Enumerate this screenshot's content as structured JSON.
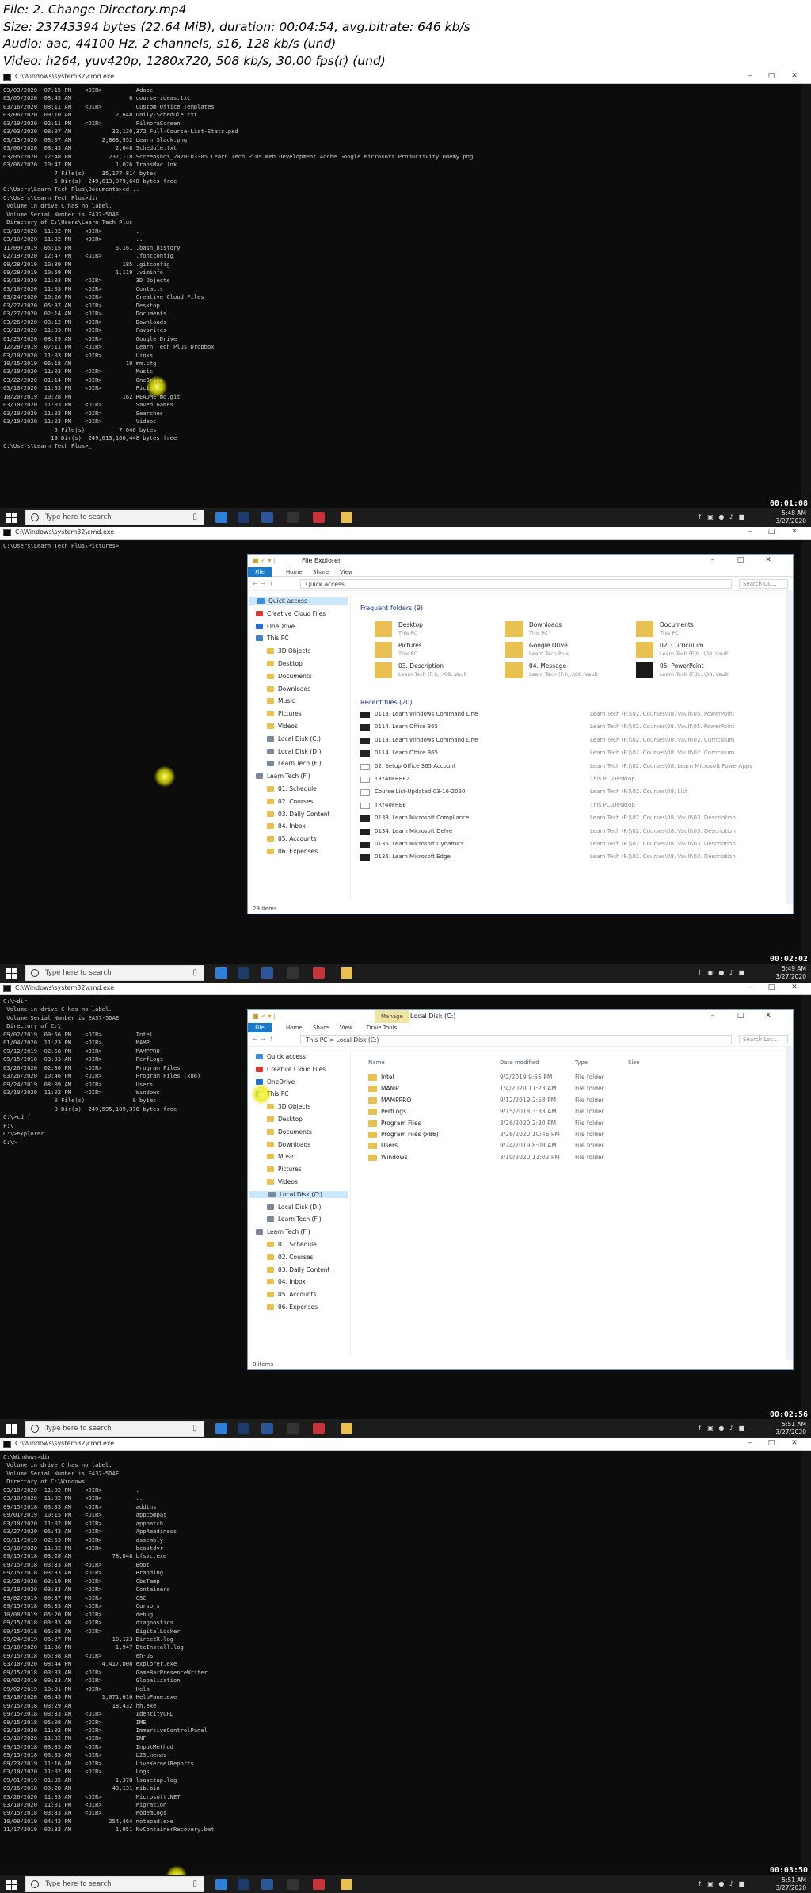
{
  "header": {
    "file_line": "File: 2. Change Directory.mp4",
    "size_line": "Size: 23743394 bytes (22.64 MiB), duration: 00:04:54, avg.bitrate: 646 kb/s",
    "audio_line": "Audio: aac, 44100 Hz, 2 channels, s16, 128 kb/s (und)",
    "video_line": "Video: h264, yuv420p, 1280x720, 508 kb/s, 30.00 fps(r) (und)"
  },
  "frames": [
    {
      "window_title": "C:\\Windows\\system32\\cmd.exe",
      "terminal_lines": [
        "03/03/2020  07:15 PM    <DIR>          Adobe",
        "03/05/2020  08:45 AM                 0 course-ideas.txt",
        "03/16/2020  08:11 AM    <DIR>          Custom Office Templates",
        "03/06/2020  09:10 AM             2,648 Daily-Schedule.txt",
        "03/19/2020  02:11 PM    <DIR>          FilmoraScreen",
        "03/03/2020  08:07 AM            32,130,372 Full-Course-List-Stats.psd",
        "03/13/2020  08:07 AM         2,803,952 Learn_Slack.png",
        "03/06/2020  08:43 AM             2,648 Schedule.txt",
        "03/05/2020  12:48 PM           237,118 Screenshot_2020-03-05 Learn Tech Plus Web Development Adobe Google Microsoft Productivity Udemy.png",
        "03/06/2020  10:47 PM             1,076 TransMac.lnk",
        "               7 File(s)     35,177,814 bytes",
        "               5 Dir(s)  249,613,979,648 bytes free",
        "",
        "C:\\Users\\Learn Tech Plus\\Documents>cd ..",
        "",
        "C:\\Users\\Learn Tech Plus>dir",
        " Volume in drive C has no label.",
        " Volume Serial Number is EA37-5DAE",
        "",
        " Directory of C:\\Users\\Learn Tech Plus",
        "",
        "03/10/2020  11:02 PM    <DIR>          .",
        "03/10/2020  11:02 PM    <DIR>          ..",
        "11/09/2019  05:15 PM             6,161 .bash_history",
        "02/19/2020  12:47 PM    <DIR>          .fontconfig",
        "09/28/2019  10:39 PM               185 .gitconfig",
        "09/28/2019  10:59 PM             1,119 .viminfo",
        "03/10/2020  11:03 PM    <DIR>          3D Objects",
        "03/10/2020  11:03 PM    <DIR>          Contacts",
        "03/24/2020  10:26 PM    <DIR>          Creative Cloud Files",
        "03/27/2020  05:37 AM    <DIR>          Desktop",
        "03/27/2020  02:14 AM    <DIR>          Documents",
        "03/26/2020  03:12 PM    <DIR>          Downloads",
        "03/10/2020  11:03 PM    <DIR>          Favorites",
        "01/23/2020  08:29 AM    <DIR>          Google Drive",
        "12/28/2019  07:11 PM    <DIR>          Learn Tech Plus Dropbox",
        "03/10/2020  11:03 PM    <DIR>          Links",
        "10/15/2019  06:18 AM                19 mm.cfg",
        "03/10/2020  11:03 PM    <DIR>          Music",
        "03/22/2020  01:14 PM    <DIR>          OneDrive",
        "03/10/2020  11:03 PM    <DIR>          Pictures",
        "10/20/2019  10:28 PM               162 README.md.git",
        "03/10/2020  11:03 PM    <DIR>          Saved Games",
        "03/10/2020  11:03 PM    <DIR>          Searches",
        "03/10/2020  11:03 PM    <DIR>          Videos",
        "               5 File(s)          7,646 bytes",
        "              19 Dir(s)  249,613,160,448 bytes free",
        "",
        "C:\\Users\\Learn Tech Plus>_"
      ],
      "taskbar_search": "Type here to search",
      "clock_time": "5:48 AM",
      "clock_date": "3/27/2020",
      "timestamp": "00:01:08"
    },
    {
      "window_title": "C:\\Windows\\system32\\cmd.exe",
      "terminal_lines": [
        "C:\\Users\\Learn Tech Plus\\Pictures>"
      ],
      "explorer": {
        "title": "File Explorer",
        "tabs": [
          "File",
          "Home",
          "Share",
          "View"
        ],
        "address": "Quick access",
        "search_placeholder": "Search Qu...",
        "status": "29 items",
        "nav_items": [
          "Quick access",
          "Creative Cloud Files",
          "OneDrive",
          "This PC",
          "3D Objects",
          "Desktop",
          "Documents",
          "Downloads",
          "Music",
          "Pictures",
          "Videos",
          "Local Disk (C:)",
          "Local Disk (D:)",
          "Learn Tech (F:)",
          "Learn Tech (F:)",
          "01. Schedule",
          "02. Courses",
          "03. Daily Content",
          "04. Inbox",
          "05. Accounts",
          "06. Expenses"
        ],
        "frequent_header": "Frequent folders (9)",
        "frequent": [
          {
            "name": "Desktop",
            "sub": "This PC"
          },
          {
            "name": "Downloads",
            "sub": "This PC"
          },
          {
            "name": "Documents",
            "sub": "This PC"
          },
          {
            "name": "Pictures",
            "sub": "This PC"
          },
          {
            "name": "Google Drive",
            "sub": "Learn Tech Plus"
          },
          {
            "name": "02. Curriculum",
            "sub": "Learn Tech (F:)\\...\\08. Vault"
          },
          {
            "name": "03. Description",
            "sub": "Learn Tech (F:)\\...\\08. Vault"
          },
          {
            "name": "04. Message",
            "sub": "Learn Tech (F:)\\...\\08. Vault"
          },
          {
            "name": "05. PowerPoint",
            "sub": "Learn Tech (F:)\\...\\08. Vault"
          }
        ],
        "recent_header": "Recent files (20)",
        "recent": [
          {
            "name": "0113. Learn Windows Command Line",
            "path": "Learn Tech (F:)\\02. Courses\\08. Vault\\05. PowerPoint"
          },
          {
            "name": "0114. Learn Office 365",
            "path": "Learn Tech (F:)\\02. Courses\\08. Vault\\05. PowerPoint"
          },
          {
            "name": "0113. Learn Windows Command Line",
            "path": "Learn Tech (F:)\\02. Courses\\08. Vault\\02. Curriculum"
          },
          {
            "name": "0114. Learn Office 365",
            "path": "Learn Tech (F:)\\02. Courses\\08. Vault\\02. Curriculum"
          },
          {
            "name": "02. Setup Office 365 Account",
            "path": "Learn Tech (F:)\\02. Courses\\08. Learn Microsoft PowerApps"
          },
          {
            "name": "TRY40FREE2",
            "path": "This PC\\Desktop"
          },
          {
            "name": "Course List-Updated-03-16-2020",
            "path": "Learn Tech (F:)\\02. Courses\\08. List"
          },
          {
            "name": "TRY40FREE",
            "path": "This PC\\Desktop"
          },
          {
            "name": "0133. Learn Microsoft Compliance",
            "path": "Learn Tech (F:)\\02. Courses\\08. Vault\\03. Description"
          },
          {
            "name": "0134. Learn Microsoft Delve",
            "path": "Learn Tech (F:)\\02. Courses\\08. Vault\\03. Description"
          },
          {
            "name": "0135. Learn Microsoft Dynamics",
            "path": "Learn Tech (F:)\\02. Courses\\08. Vault\\03. Description"
          },
          {
            "name": "0136. Learn Microsoft Edge",
            "path": "Learn Tech (F:)\\02. Courses\\08. Vault\\03. Description"
          }
        ]
      },
      "taskbar_search": "Type here to search",
      "clock_time": "5:49 AM",
      "clock_date": "3/27/2020",
      "timestamp": "00:02:02"
    },
    {
      "window_title": "C:\\Windows\\system32\\cmd.exe",
      "terminal_lines": [
        "C:\\>dir",
        " Volume in drive C has no label.",
        " Volume Serial Number is EA37-5DAE",
        "",
        " Directory of C:\\",
        "",
        "09/02/2019  09:56 PM    <DIR>          Intel",
        "01/04/2020  11:23 PM    <DIR>          MAMP",
        "09/12/2019  02:58 PM    <DIR>          MAMPPRO",
        "09/15/2018  03:33 AM    <DIR>          PerfLogs",
        "03/26/2020  02:30 PM    <DIR>          Program Files",
        "03/26/2020  10:46 PM    <DIR>          Program Files (x86)",
        "09/24/2019  08:09 AM    <DIR>          Users",
        "03/10/2020  11:02 PM    <DIR>          Windows",
        "               0 File(s)              0 bytes",
        "               8 Dir(s)  249,595,109,376 bytes free",
        "",
        "C:\\>cd f:",
        "F:\\",
        "",
        "C:\\>explorer .",
        "",
        "C:\\>"
      ],
      "explorer": {
        "title": "Local Disk (C:)",
        "manage": "Manage",
        "tabs": [
          "File",
          "Home",
          "Share",
          "View",
          "Drive Tools"
        ],
        "address": "This PC  >  Local Disk (C:)",
        "search_placeholder": "Search Loc...",
        "status": "8 items",
        "columns": [
          "Name",
          "Date modified",
          "Type",
          "Size"
        ],
        "nav_items": [
          "Quick access",
          "Creative Cloud Files",
          "OneDrive",
          "This PC",
          "3D Objects",
          "Desktop",
          "Documents",
          "Downloads",
          "Music",
          "Pictures",
          "Videos",
          "Local Disk (C:)",
          "Local Disk (D:)",
          "Learn Tech (F:)",
          "Learn Tech (F:)",
          "01. Schedule",
          "02. Courses",
          "03. Daily Content",
          "04. Inbox",
          "05. Accounts",
          "06. Expenses"
        ],
        "rows": [
          {
            "name": "Intel",
            "date": "9/2/2019 9:56 PM",
            "type": "File folder"
          },
          {
            "name": "MAMP",
            "date": "1/4/2020 11:23 AM",
            "type": "File folder"
          },
          {
            "name": "MAMPPRO",
            "date": "9/12/2019 2:58 PM",
            "type": "File folder"
          },
          {
            "name": "PerfLogs",
            "date": "9/15/2018 3:33 AM",
            "type": "File folder"
          },
          {
            "name": "Program Files",
            "date": "3/26/2020 2:30 PM",
            "type": "File folder"
          },
          {
            "name": "Program Files (x86)",
            "date": "3/26/2020 10:46 PM",
            "type": "File folder"
          },
          {
            "name": "Users",
            "date": "9/24/2019 8:09 AM",
            "type": "File folder"
          },
          {
            "name": "Windows",
            "date": "3/10/2020 11:02 PM",
            "type": "File folder"
          }
        ]
      },
      "taskbar_search": "Type here to search",
      "clock_time": "5:51 AM",
      "clock_date": "3/27/2020",
      "timestamp": "00:02:56"
    },
    {
      "window_title": "C:\\Windows\\system32\\cmd.exe",
      "terminal_lines": [
        "C:\\Windows>dir",
        " Volume in drive C has no label.",
        " Volume Serial Number is EA37-5DAE",
        "",
        " Directory of C:\\Windows",
        "",
        "03/10/2020  11:02 PM    <DIR>          .",
        "03/10/2020  11:02 PM    <DIR>          ..",
        "09/15/2018  03:33 AM    <DIR>          addins",
        "09/01/2019  10:15 PM    <DIR>          appcompat",
        "03/10/2020  11:02 PM    <DIR>          apppatch",
        "03/27/2020  05:43 AM    <DIR>          AppReadiness",
        "09/11/2019  02:53 PM    <DIR>          assembly",
        "03/10/2020  11:02 PM    <DIR>          bcastdvr",
        "09/15/2018  03:28 AM            78,848 bfsvc.exe",
        "09/15/2018  03:33 AM    <DIR>          Boot",
        "09/15/2018  03:33 AM    <DIR>          Branding",
        "03/26/2020  03:19 PM    <DIR>          CbsTemp",
        "03/10/2020  03:33 AM    <DIR>          Containers",
        "09/02/2019  09:37 PM    <DIR>          CSC",
        "09/15/2018  03:33 AM    <DIR>          Cursors",
        "10/08/2019  05:20 PM    <DIR>          debug",
        "09/15/2018  03:33 AM    <DIR>          diagnostics",
        "09/15/2018  05:08 AM    <DIR>          DigitalLocker",
        "09/24/2019  06:27 PM            10,123 DirectX.log",
        "03/10/2020  11:36 PM             1,947 DtcInstall.log",
        "09/15/2018  05:08 AM    <DIR>          en-US",
        "03/10/2020  08:44 PM         4,417,008 explorer.exe",
        "09/15/2018  03:33 AM    <DIR>          GameBarPresenceWriter",
        "09/02/2019  09:33 AM    <DIR>          Globalization",
        "09/02/2019  10:01 PM    <DIR>          Help",
        "03/10/2020  08:45 PM         1,071,616 HelpPane.exe",
        "09/15/2018  03:29 AM            18,432 hh.exe",
        "09/15/2018  03:33 AM    <DIR>          IdentityCRL",
        "09/15/2018  05:08 AM    <DIR>          IME",
        "03/10/2020  11:02 PM    <DIR>          ImmersiveControlPanel",
        "03/10/2020  11:02 PM    <DIR>          INF",
        "09/15/2018  03:33 AM    <DIR>          InputMethod",
        "09/15/2018  03:33 AM    <DIR>          L2Schemas",
        "09/23/2019  11:16 AM    <DIR>          LiveKernelReports",
        "03/10/2020  11:02 PM    <DIR>          Logs",
        "09/01/2019  01:35 AM             1,378 lsasetup.log",
        "09/15/2018  03:28 AM            43,131 mib.bin",
        "03/26/2020  11:03 AM    <DIR>          Microsoft.NET",
        "03/10/2020  11:01 PM    <DIR>          Migration",
        "09/15/2018  03:33 AM    <DIR>          ModemLogs",
        "10/09/2019  04:42 PM           254,464 notepad.exe",
        "11/17/2019  02:32 AM             1,951 NvContainerRecovery.bat"
      ],
      "taskbar_search": "Type here to search",
      "clock_time": "5:51 AM",
      "clock_date": "3/27/2020",
      "timestamp": "00:03:50"
    }
  ],
  "colors": {
    "terminal_bg": "#0c0c0c",
    "terminal_fg": "#cccccc",
    "taskbar": "#1c1c1c",
    "accent": "#1979ca",
    "folder": "#e8c152"
  }
}
